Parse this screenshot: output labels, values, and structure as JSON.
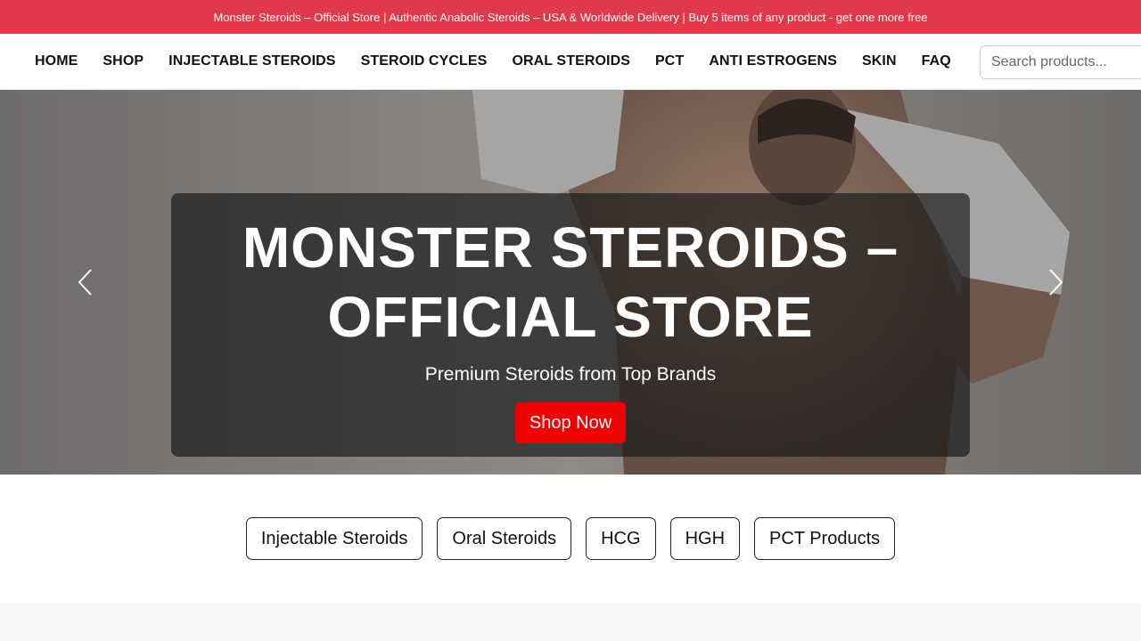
{
  "announcement": "Monster Steroids – Official Store | Authentic Anabolic Steroids – USA & Worldwide Delivery | Buy 5 items of any product - get one more free",
  "nav": {
    "links": [
      "HOME",
      "SHOP",
      "INJECTABLE STEROIDS",
      "STEROID CYCLES",
      "ORAL STEROIDS",
      "PCT",
      "ANTI ESTROGENS",
      "SKIN",
      "FAQ"
    ],
    "search_placeholder": "Search products..."
  },
  "hero": {
    "title_line1": "MONSTER STEROIDS –",
    "title_line2": "OFFICIAL STORE",
    "subtitle": "Premium Steroids from Top Brands",
    "cta_label": "Shop Now",
    "cta_color": "#f00000",
    "overlay_color": "rgba(25,25,25,0.68)"
  },
  "categories": [
    "Injectable Steroids",
    "Oral Steroids",
    "HCG",
    "HGH",
    "PCT Products"
  ],
  "colors": {
    "announcement_bg": "#e03a4a",
    "nav_text": "#111111",
    "footer_band": "#f6f7f9"
  },
  "icons": {
    "prev": "chevron-left-icon",
    "next": "chevron-right-icon"
  }
}
